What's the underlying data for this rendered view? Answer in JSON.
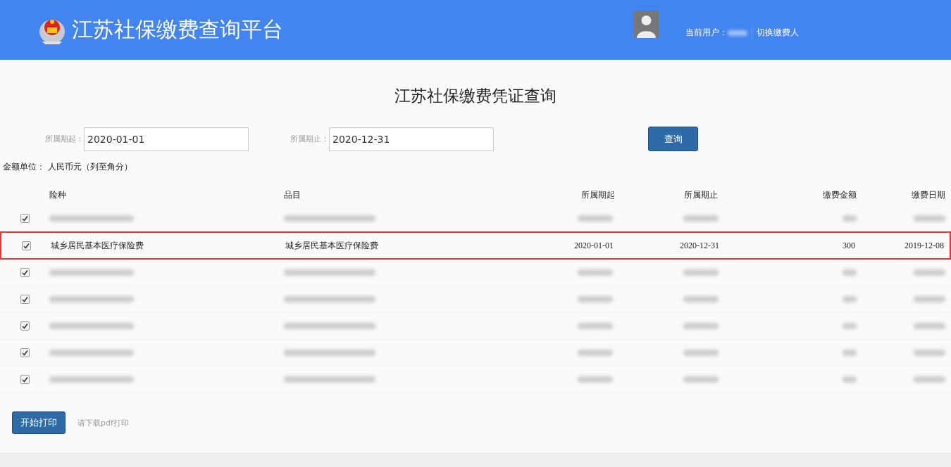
{
  "header": {
    "title": "江苏社保缴费查询平台",
    "user_label": "当前用户：",
    "switch_link": "切换缴费人"
  },
  "page_title": "江苏社保缴费凭证查询",
  "filters": [
    {
      "label": "所属期起：",
      "value": "2020-01-01"
    },
    {
      "label": "所属期止：",
      "value": "2020-12-31"
    }
  ],
  "query_button": "查询",
  "unit_note": "金额单位： 人民币元（列至角分）",
  "table": {
    "columns": [
      "险种",
      "品目",
      "所属期起",
      "所属期止",
      "缴费金额",
      "缴费日期"
    ],
    "rows": [
      {
        "kind": "blurred",
        "checked": true,
        "highlighted": false
      },
      {
        "kind": "text",
        "checked": true,
        "highlighted": true,
        "cells": [
          "城乡居民基本医疗保险费",
          "城乡居民基本医疗保险费",
          "2020-01-01",
          "2020-12-31",
          "300",
          "2019-12-08"
        ]
      },
      {
        "kind": "blurred",
        "checked": true,
        "highlighted": false
      },
      {
        "kind": "blurred",
        "checked": true,
        "highlighted": false
      },
      {
        "kind": "blurred",
        "checked": true,
        "highlighted": false
      },
      {
        "kind": "blurred",
        "checked": true,
        "highlighted": false
      },
      {
        "kind": "blurred",
        "checked": true,
        "highlighted": false
      }
    ]
  },
  "print_button": "开始打印",
  "print_hint": "请下载pdf打印"
}
